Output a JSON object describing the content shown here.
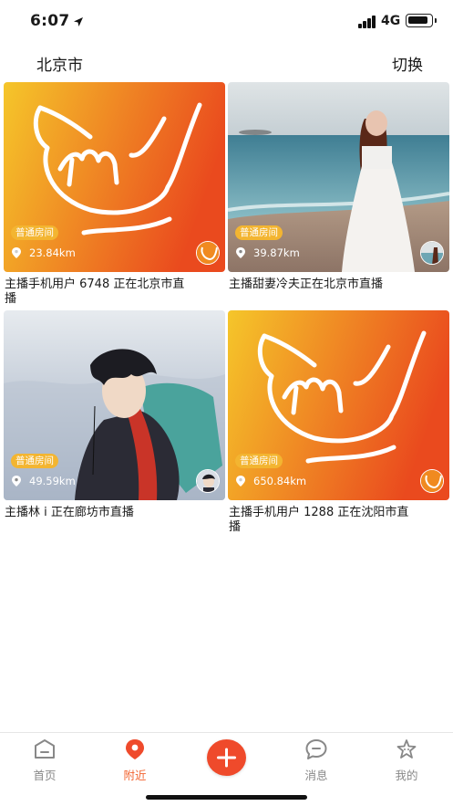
{
  "status_bar": {
    "time": "6:07",
    "network": "4G"
  },
  "header": {
    "city": "北京市",
    "switch_label": "切换"
  },
  "cards": [
    {
      "room_type": "普通房间",
      "distance": "23.84km",
      "caption": "主播手机用户 6748 正在北京市直播",
      "cover": "logo",
      "avatar": "logo"
    },
    {
      "room_type": "普通房间",
      "distance": "39.87km",
      "caption": "主播甜妻冷夫正在北京市直播",
      "cover": "beach-photo",
      "avatar": "beach-photo"
    },
    {
      "room_type": "普通房间",
      "distance": "49.59km",
      "caption": "主播林 i 正在廊坊市直播",
      "cover": "anime-boy-illustration",
      "avatar": "anime-boy-illustration"
    },
    {
      "room_type": "普通房间",
      "distance": "650.84km",
      "caption": "主播手机用户 1288 正在沈阳市直播",
      "cover": "logo",
      "avatar": "logo"
    }
  ],
  "tabbar": {
    "items": [
      {
        "label": "首页",
        "icon": "home-icon",
        "active": false
      },
      {
        "label": "附近",
        "icon": "nearby-icon",
        "active": true
      },
      {
        "label": "",
        "icon": "plus-icon",
        "active": false
      },
      {
        "label": "消息",
        "icon": "message-icon",
        "active": false
      },
      {
        "label": "我的",
        "icon": "profile-icon",
        "active": false
      }
    ]
  },
  "colors": {
    "accent": "#f2632f",
    "badge": "#f3b531",
    "logo_gradient_start": "#f5c62a",
    "logo_gradient_end": "#ea4a1e"
  }
}
